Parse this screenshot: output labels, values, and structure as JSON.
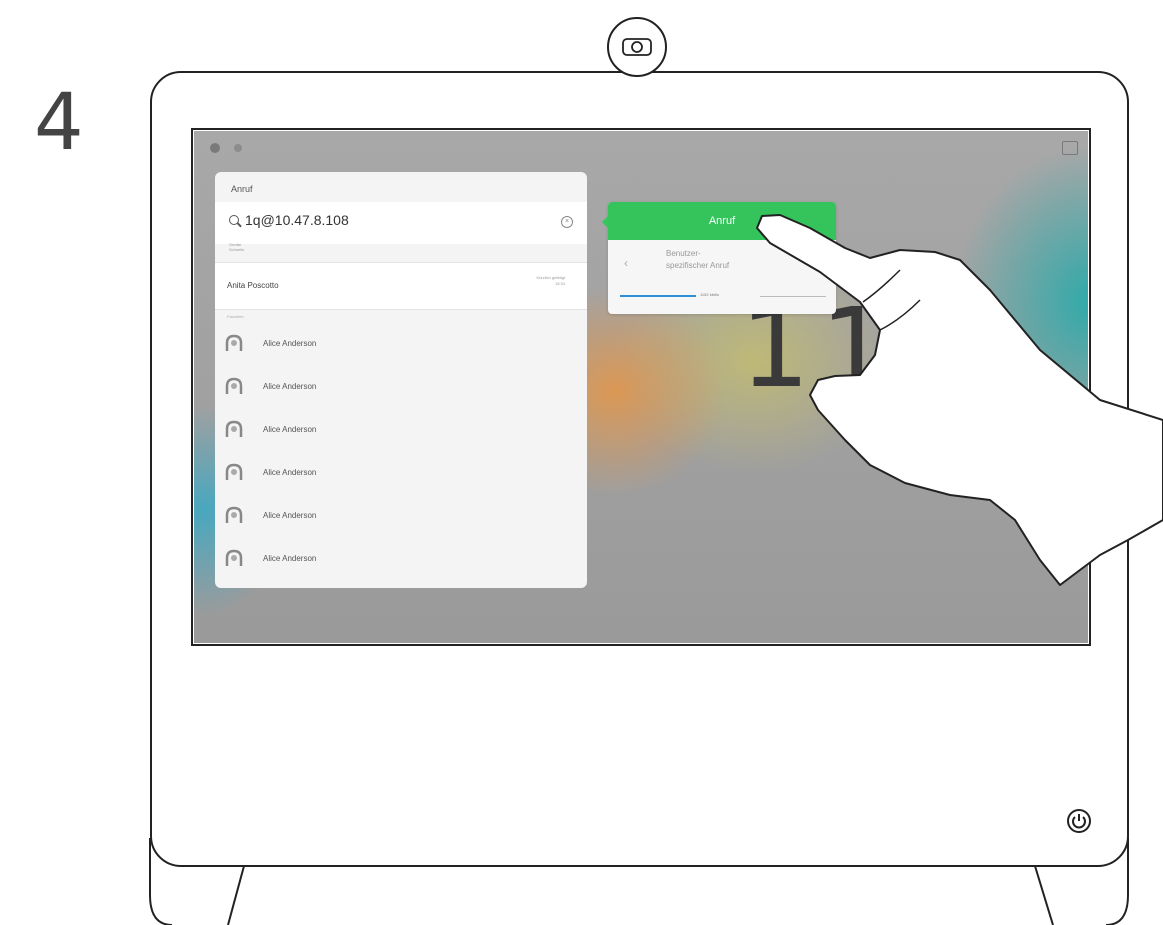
{
  "step_number": "4",
  "screen": {
    "clock_partial": "11:4",
    "search_panel": {
      "title": "Anruf",
      "search_value": "1q@10.47.8.108",
      "search_sub": "Geräte\nSchnelle",
      "clear_icon": "x-circle-icon",
      "recent_entry": {
        "name": "Anita Poscotto",
        "meta": "Kürzlich getätigt\n15:34"
      },
      "section_label": "Favoriten",
      "contacts": [
        {
          "name": "Alice Anderson"
        },
        {
          "name": "Alice Anderson"
        },
        {
          "name": "Alice Anderson"
        },
        {
          "name": "Alice Anderson"
        },
        {
          "name": "Alice Anderson"
        },
        {
          "name": "Alice Anderson"
        }
      ]
    },
    "call_popup": {
      "call_button_label": "Anruf",
      "custom_call_label": "Benutzer-\nspezifischer Anruf",
      "bandwidth_label": "1152 kbit/s",
      "bandwidth_fraction": 0.55,
      "call_button_color": "#35c35c"
    }
  },
  "device": {
    "camera_icon": "camera-icon",
    "power_icon": "power-icon"
  }
}
